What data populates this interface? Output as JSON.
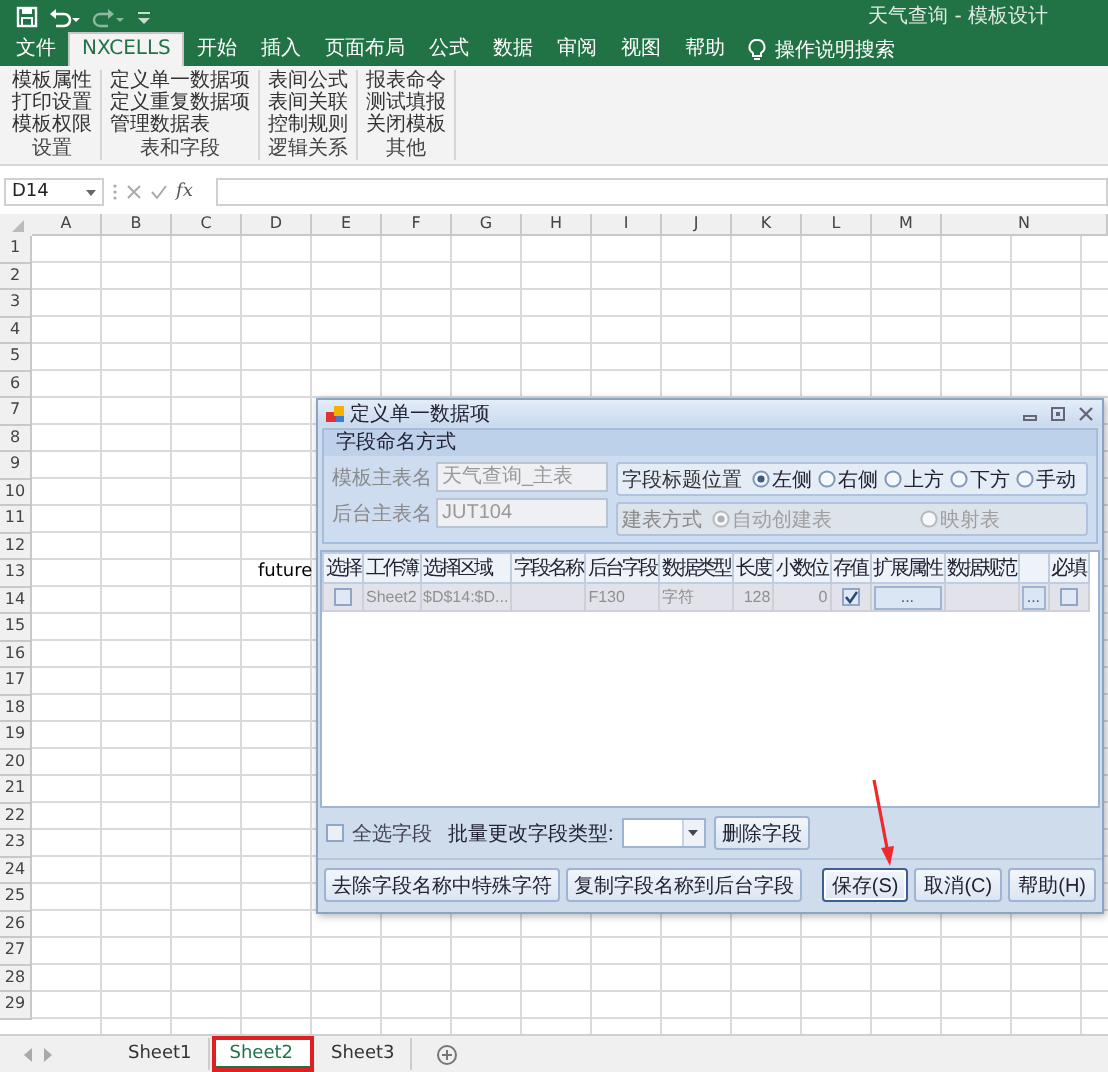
{
  "window": {
    "title": "天气查询 - 模板设计"
  },
  "ribbon_tabs": [
    {
      "label": "文件",
      "selected": false
    },
    {
      "label": "NXCELLS",
      "selected": true
    },
    {
      "label": "开始",
      "selected": false
    },
    {
      "label": "插入",
      "selected": false
    },
    {
      "label": "页面布局",
      "selected": false
    },
    {
      "label": "公式",
      "selected": false
    },
    {
      "label": "数据",
      "selected": false
    },
    {
      "label": "审阅",
      "selected": false
    },
    {
      "label": "视图",
      "selected": false
    },
    {
      "label": "帮助",
      "selected": false
    }
  ],
  "tell_me": {
    "placeholder": "操作说明搜索"
  },
  "ribbon_groups": [
    {
      "label": "设置",
      "commands": [
        "模板属性",
        "打印设置",
        "模板权限"
      ]
    },
    {
      "label": "表和字段",
      "commands": [
        "定义单一数据项",
        "定义重复数据项",
        "管理数据表"
      ]
    },
    {
      "label": "逻辑关系",
      "commands": [
        "表间公式",
        "表间关联",
        "控制规则"
      ]
    },
    {
      "label": "其他",
      "commands": [
        "报表命令",
        "测试填报",
        "关闭模板"
      ]
    }
  ],
  "formula_bar": {
    "name_box": "D14",
    "function_label": "fx"
  },
  "sheet": {
    "columns": [
      "A",
      "B",
      "C",
      "D",
      "E",
      "F",
      "G",
      "H",
      "I",
      "J",
      "K",
      "L",
      "M",
      "N"
    ],
    "rows": [
      {
        "number": "1"
      },
      {
        "number": "2"
      },
      {
        "number": "3"
      },
      {
        "number": "4"
      },
      {
        "number": "5"
      },
      {
        "number": "6"
      },
      {
        "number": "7"
      },
      {
        "number": "8"
      },
      {
        "number": "9"
      },
      {
        "number": "10"
      },
      {
        "number": "11"
      },
      {
        "number": "12"
      },
      {
        "number": "13",
        "cells": [
          null,
          null,
          null,
          "future"
        ]
      },
      {
        "number": "14"
      },
      {
        "number": "15"
      },
      {
        "number": "16"
      },
      {
        "number": "17"
      },
      {
        "number": "18"
      },
      {
        "number": "19"
      },
      {
        "number": "20"
      },
      {
        "number": "21"
      },
      {
        "number": "22"
      },
      {
        "number": "23"
      },
      {
        "number": "24"
      },
      {
        "number": "25"
      },
      {
        "number": "26"
      },
      {
        "number": "27"
      },
      {
        "number": "28"
      },
      {
        "number": "29"
      }
    ]
  },
  "dialog": {
    "title": "定义单一数据项",
    "naming": {
      "title": "字段命名方式",
      "fields": [
        {
          "label": "模板主表名",
          "value": "天气查询_主表",
          "disabled": true
        },
        {
          "label": "后台主表名",
          "value": "JUT104",
          "disabled": true
        }
      ],
      "title_position": {
        "label": "字段标题位置",
        "disabled": false,
        "options": [
          {
            "label": "左侧",
            "selected": true
          },
          {
            "label": "右侧",
            "selected": false
          },
          {
            "label": "上方",
            "selected": false
          },
          {
            "label": "下方",
            "selected": false
          },
          {
            "label": "手动",
            "selected": false
          }
        ]
      },
      "table_creation": {
        "label": "建表方式",
        "disabled": true,
        "options": [
          {
            "label": "自动创建表",
            "selected": true
          },
          {
            "label": "映射表",
            "selected": false
          }
        ]
      }
    },
    "grid": {
      "columns": [
        {
          "label": "选择"
        },
        {
          "label": "工作簿"
        },
        {
          "label": "选择区域"
        },
        {
          "label": "字段名称"
        },
        {
          "label": "后台字段"
        },
        {
          "label": "数据类型"
        },
        {
          "label": "长度"
        },
        {
          "label": "小数位"
        },
        {
          "label": "存值"
        },
        {
          "label": "扩展属性"
        },
        {
          "label": "数据规范"
        },
        {},
        {
          "label": "必填"
        }
      ],
      "rows": [
        {
          "cells": [
            {
              "kind": "checkbox",
              "checked": false
            },
            {
              "kind": "text",
              "text": "Sheet2"
            },
            {
              "kind": "text",
              "text": "$D$14:$D..."
            },
            {
              "kind": "empty"
            },
            {
              "kind": "text",
              "text": "F130"
            },
            {
              "kind": "text",
              "text": "字符"
            },
            {
              "kind": "number",
              "text": "128"
            },
            {
              "kind": "number",
              "text": "0"
            },
            {
              "kind": "checkbox",
              "checked": true
            },
            {
              "kind": "button",
              "text": "..."
            },
            {
              "kind": "empty"
            },
            {
              "kind": "button",
              "text": "..."
            },
            {
              "kind": "checkbox",
              "checked": false
            }
          ]
        }
      ]
    },
    "select_all": {
      "label": "全选字段",
      "checked": false
    },
    "batch_type": {
      "label": "批量更改字段类型:"
    },
    "delete_button": "删除字段",
    "buttons": [
      {
        "label": "去除字段名称中特殊字符",
        "kind": "tool",
        "focused": false
      },
      {
        "label": "复制字段名称到后台字段",
        "kind": "tool",
        "focused": false
      },
      {
        "label": "保存(S)",
        "kind": "confirm",
        "focused": true
      },
      {
        "label": "取消(C)",
        "kind": "confirm",
        "focused": false
      },
      {
        "label": "帮助(H)",
        "kind": "confirm",
        "focused": false
      }
    ],
    "annotation": {
      "kind": "arrow"
    }
  },
  "sheet_tabs": [
    {
      "label": "Sheet1",
      "selected": false,
      "highlighted": false
    },
    {
      "label": "Sheet2",
      "selected": true,
      "highlighted": true
    },
    {
      "label": "Sheet3",
      "selected": false,
      "highlighted": false
    }
  ]
}
